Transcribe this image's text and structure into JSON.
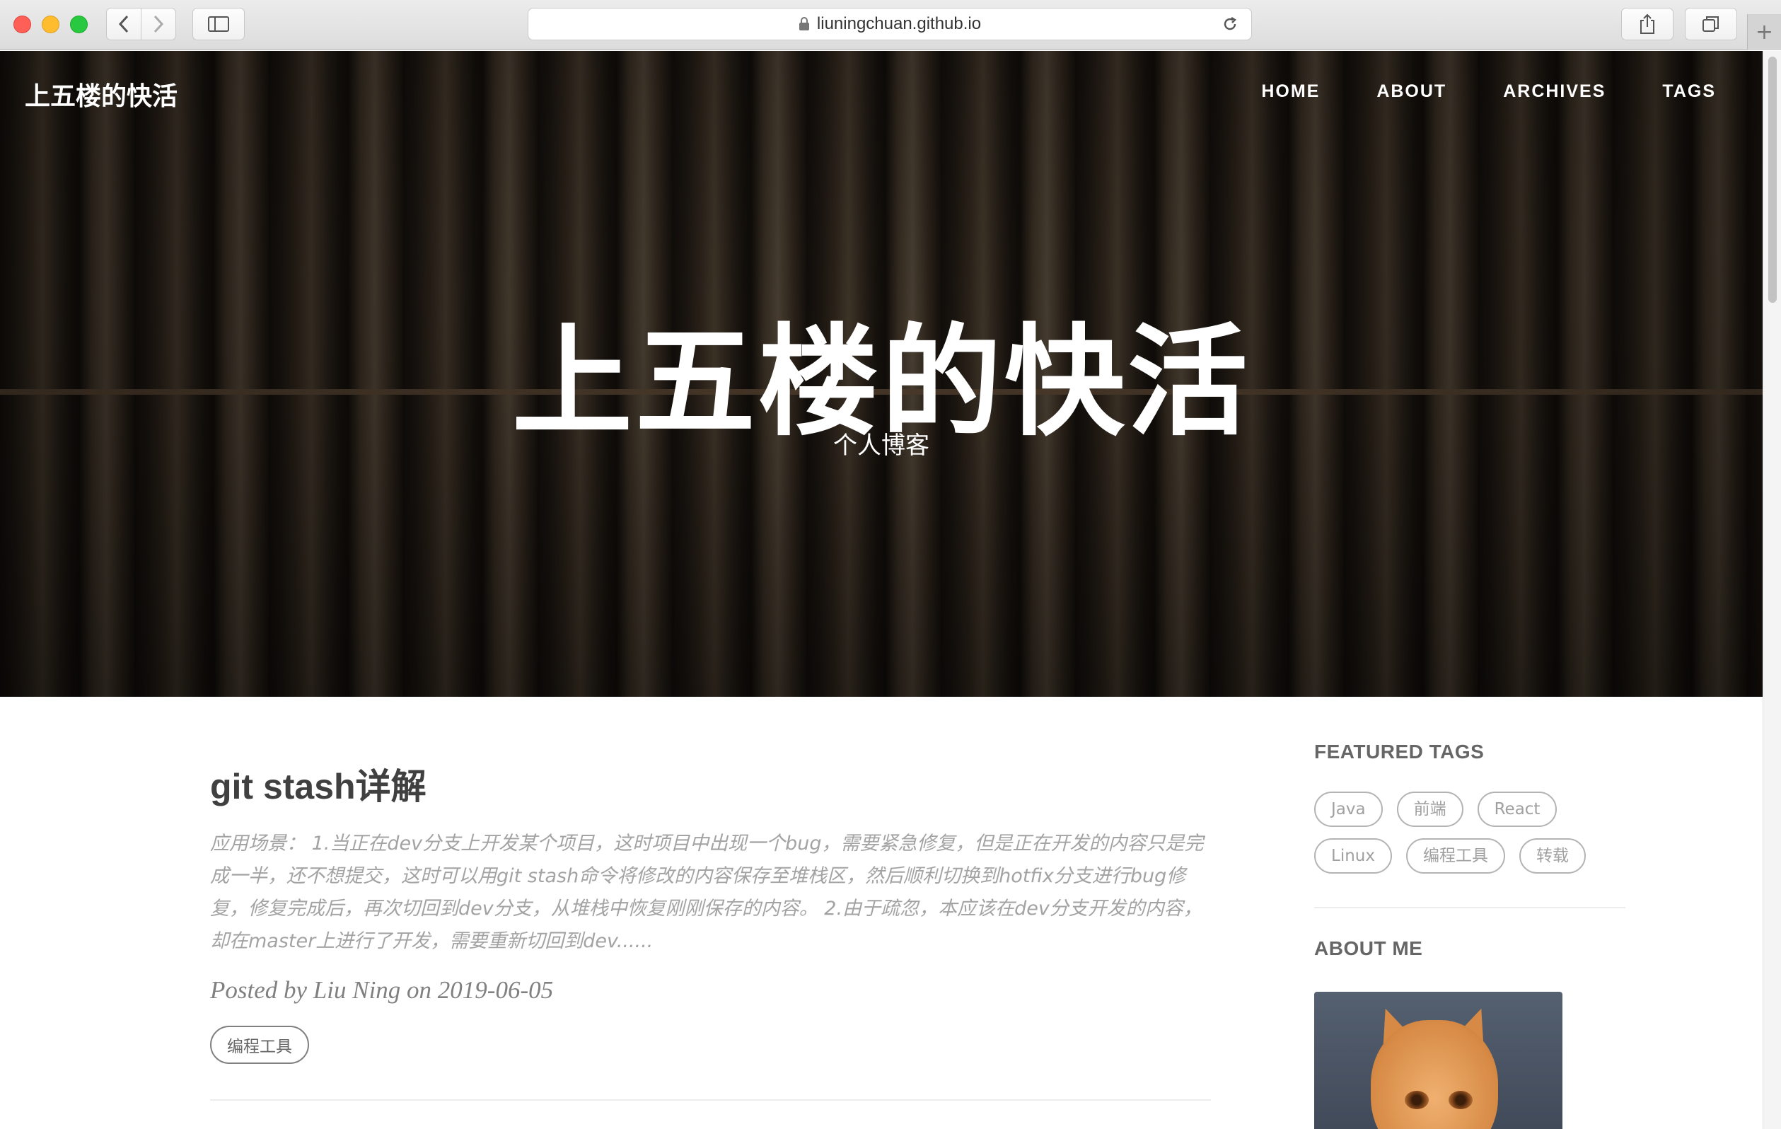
{
  "browser": {
    "url": "liuningchuan.github.io"
  },
  "site": {
    "brand": "上五楼的快活",
    "nav": [
      "HOME",
      "ABOUT",
      "ARCHIVES",
      "TAGS"
    ],
    "hero_title": "上五楼的快活",
    "hero_subtitle": "个人博客"
  },
  "post": {
    "title": "git stash详解",
    "excerpt": "应用场景： 1.当正在dev分支上开发某个项目，这时项目中出现一个bug，需要紧急修复，但是正在开发的内容只是完成一半，还不想提交，这时可以用git stash命令将修改的内容保存至堆栈区，然后顺利切换到hotfix分支进行bug修复，修复完成后，再次切回到dev分支，从堆栈中恢复刚刚保存的内容。 2.由于疏忽，本应该在dev分支开发的内容，却在master上进行了开发，需要重新切回到dev......",
    "meta": "Posted by Liu Ning on 2019-06-05",
    "tag": "编程工具"
  },
  "sidebar": {
    "featured_tags_heading": "FEATURED TAGS",
    "tags": [
      "Java",
      "前端",
      "React",
      "Linux",
      "编程工具",
      "转载"
    ],
    "about_heading": "ABOUT ME"
  },
  "icons": {
    "lock": "lock-icon",
    "reload": "reload-icon",
    "back": "chevron-left-icon",
    "forward": "chevron-right-icon",
    "sidebar": "sidebar-icon",
    "share": "share-icon",
    "tabs": "tabs-icon",
    "new_tab": "plus-icon"
  }
}
